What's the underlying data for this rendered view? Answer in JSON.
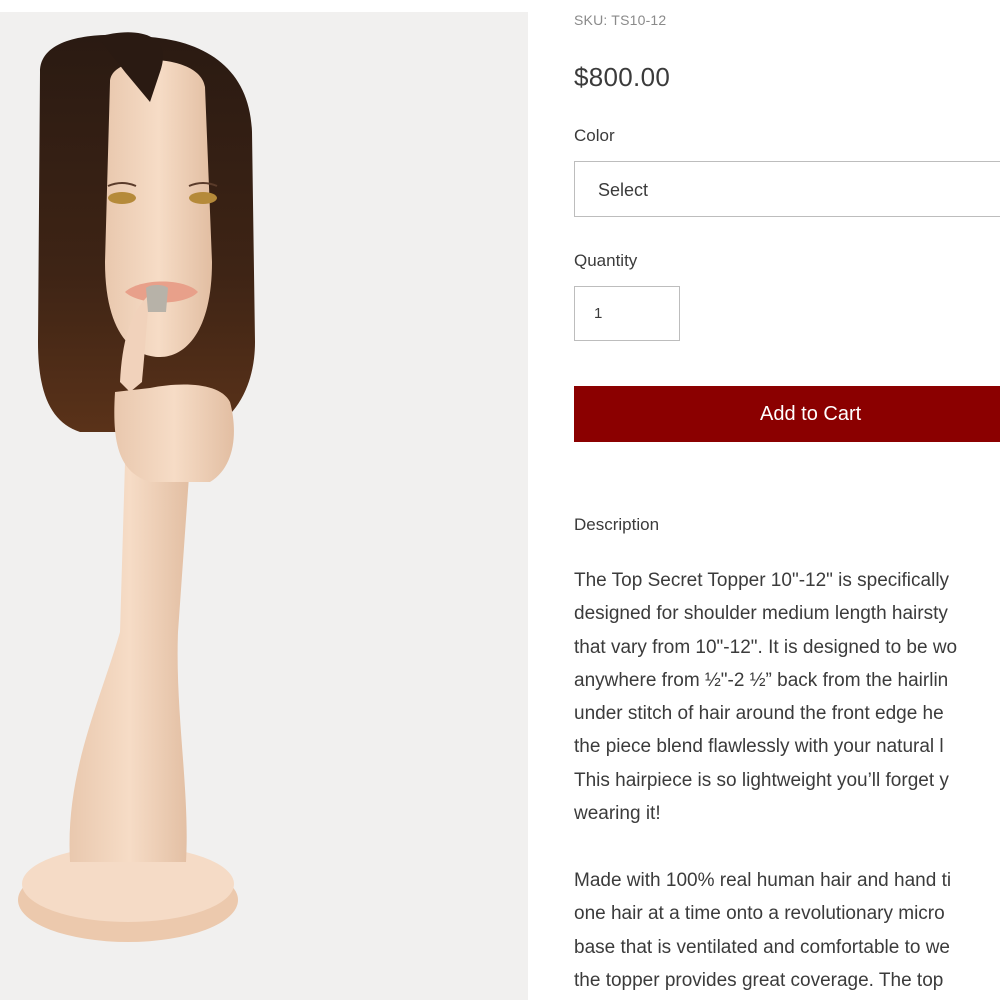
{
  "product": {
    "image_alt": "Top Secret Topper on mannequin head",
    "sku": "SKU: TS10-12",
    "price": "$800.00"
  },
  "options": {
    "color_label": "Color",
    "color_selected": "Select",
    "quantity_label": "Quantity",
    "quantity_value": "1"
  },
  "actions": {
    "add_to_cart_label": "Add to Cart",
    "add_to_cart_color": "#8b0000"
  },
  "description": {
    "heading": "Description",
    "paragraph_1_lines": [
      "The Top Secret Topper 10\"-12\" is specifically",
      "designed for shoulder medium length hairsty",
      "that vary from 10\"-12\". It is designed to be wo",
      "anywhere from ½\"-2 ½” back from the hairlin",
      "under stitch of hair around the front edge he",
      "the piece blend flawlessly with your natural l",
      "This hairpiece is so lightweight you’ll forget y",
      "wearing it!"
    ],
    "paragraph_2_lines": [
      "Made with 100% real human hair and hand ti",
      "one hair at a time onto a revolutionary micro",
      "base that is ventilated and comfortable to we",
      "the topper provides great coverage.  The top"
    ]
  }
}
